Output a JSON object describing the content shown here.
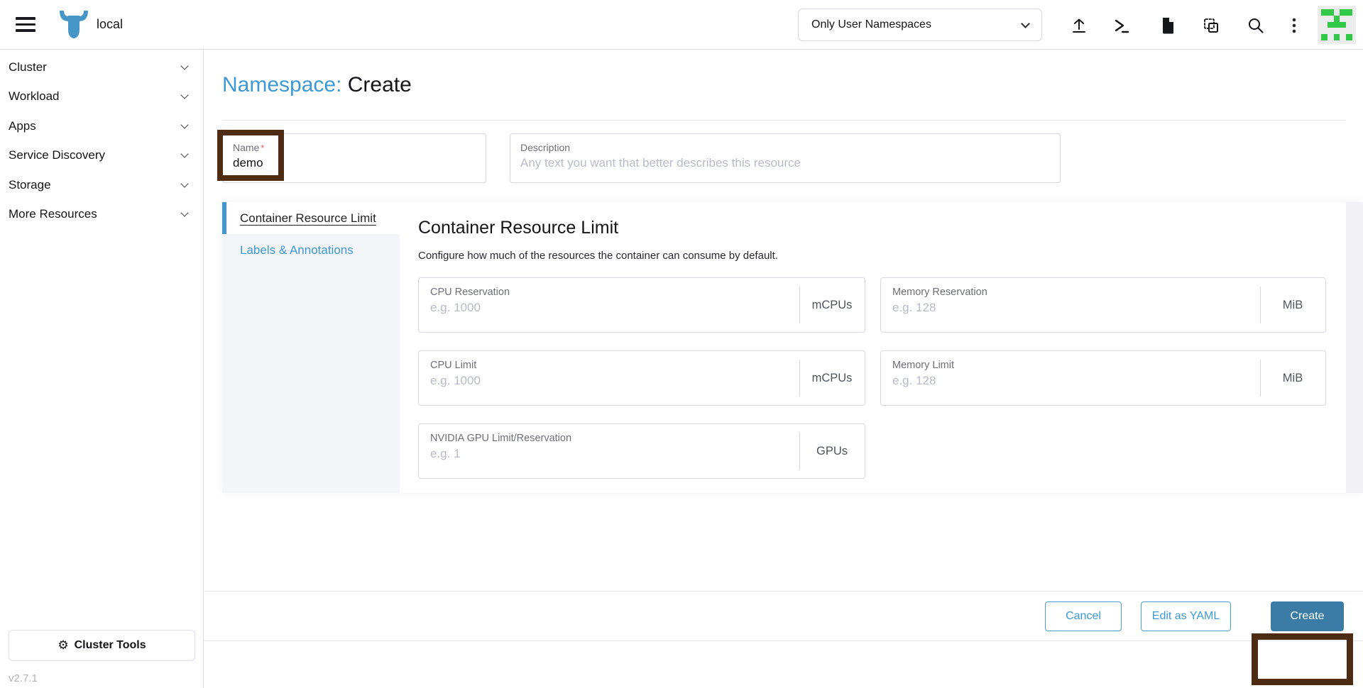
{
  "header": {
    "cluster_name": "local",
    "namespace_filter_value": "Only User Namespaces",
    "icons": [
      "upload-icon",
      "kubectl-shell-icon",
      "docs-icon",
      "import-yaml-icon",
      "search-icon",
      "kebab-menu-icon"
    ],
    "avatar": {
      "green": "#33c948",
      "background": "#ececec",
      "pattern": [
        [
          1,
          1,
          0,
          1,
          1
        ],
        [
          0,
          0,
          1,
          0,
          0
        ],
        [
          0,
          1,
          1,
          1,
          0
        ],
        [
          0,
          0,
          0,
          0,
          0
        ],
        [
          1,
          0,
          1,
          0,
          1
        ]
      ]
    }
  },
  "sidebar": {
    "items": [
      {
        "label": "Cluster"
      },
      {
        "label": "Workload"
      },
      {
        "label": "Apps"
      },
      {
        "label": "Service Discovery"
      },
      {
        "label": "Storage"
      },
      {
        "label": "More Resources"
      }
    ],
    "cluster_tools_label": "Cluster Tools",
    "version": "v2.7.1"
  },
  "page": {
    "title_prefix": "Namespace:",
    "title_action": "Create",
    "name_field": {
      "label": "Name",
      "required_mark": "*",
      "value": "demo"
    },
    "description_field": {
      "label": "Description",
      "placeholder": "Any text you want that better describes this resource"
    },
    "tabs": [
      {
        "label": "Container Resource Limit",
        "active": true
      },
      {
        "label": "Labels & Annotations",
        "active": false
      }
    ],
    "section": {
      "heading": "Container Resource Limit",
      "description": "Configure how much of the resources the container can consume by default.",
      "fields": [
        {
          "label": "CPU Reservation",
          "placeholder": "e.g. 1000",
          "suffix": "mCPUs"
        },
        {
          "label": "Memory Reservation",
          "placeholder": "e.g. 128",
          "suffix": "MiB"
        },
        {
          "label": "CPU Limit",
          "placeholder": "e.g. 1000",
          "suffix": "mCPUs"
        },
        {
          "label": "Memory Limit",
          "placeholder": "e.g. 128",
          "suffix": "MiB"
        },
        {
          "label": "NVIDIA GPU Limit/Reservation",
          "placeholder": "e.g. 1",
          "suffix": "GPUs"
        }
      ]
    },
    "footer": {
      "cancel": "Cancel",
      "edit_yaml": "Edit as YAML",
      "create": "Create"
    }
  },
  "colors": {
    "primary": "#3d98d3",
    "create_button": "#3a7ca6",
    "annotation_box": "#4e2b13"
  }
}
